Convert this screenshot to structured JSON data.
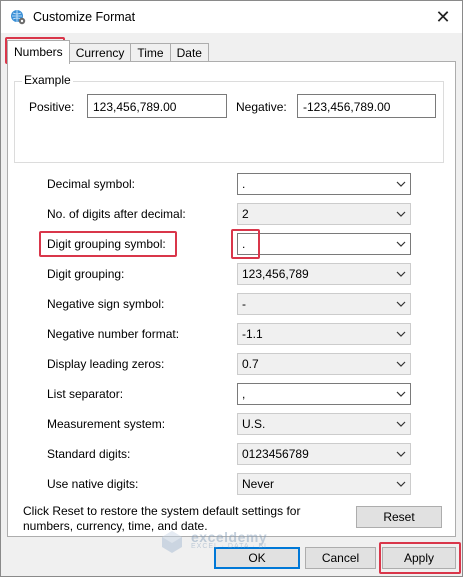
{
  "window": {
    "title": "Customize Format",
    "close_glyph": "✕"
  },
  "tabs": [
    {
      "label": "Numbers",
      "active": true
    },
    {
      "label": "Currency",
      "active": false
    },
    {
      "label": "Time",
      "active": false
    },
    {
      "label": "Date",
      "active": false
    }
  ],
  "example": {
    "group_title": "Example",
    "positive_label": "Positive:",
    "positive_value": "123,456,789.00",
    "negative_label": "Negative:",
    "negative_value": "-123,456,789.00"
  },
  "settings": [
    {
      "label": "Decimal symbol:",
      "value": ".",
      "enabled": true
    },
    {
      "label": "No. of digits after decimal:",
      "value": "2",
      "enabled": false
    },
    {
      "label": "Digit grouping symbol:",
      "value": ".",
      "enabled": true
    },
    {
      "label": "Digit grouping:",
      "value": "123,456,789",
      "enabled": false
    },
    {
      "label": "Negative sign symbol:",
      "value": "-",
      "enabled": false
    },
    {
      "label": "Negative number format:",
      "value": "-1.1",
      "enabled": false
    },
    {
      "label": "Display leading zeros:",
      "value": "0.7",
      "enabled": false
    },
    {
      "label": "List separator:",
      "value": ",",
      "enabled": true
    },
    {
      "label": "Measurement system:",
      "value": "U.S.",
      "enabled": false
    },
    {
      "label": "Standard digits:",
      "value": "0123456789",
      "enabled": false
    },
    {
      "label": "Use native digits:",
      "value": "Never",
      "enabled": false
    }
  ],
  "footer": {
    "reset_text": "Click Reset to restore the system default settings for numbers, currency, time, and date.",
    "reset_button": "Reset",
    "ok_button": "OK",
    "cancel_button": "Cancel",
    "apply_button": "Apply"
  },
  "watermark": {
    "name": "exceldemy",
    "tagline": "EXCEL · DATA · BI"
  },
  "colors": {
    "highlight": "#d9364a",
    "focus_blue": "#0078d7"
  }
}
